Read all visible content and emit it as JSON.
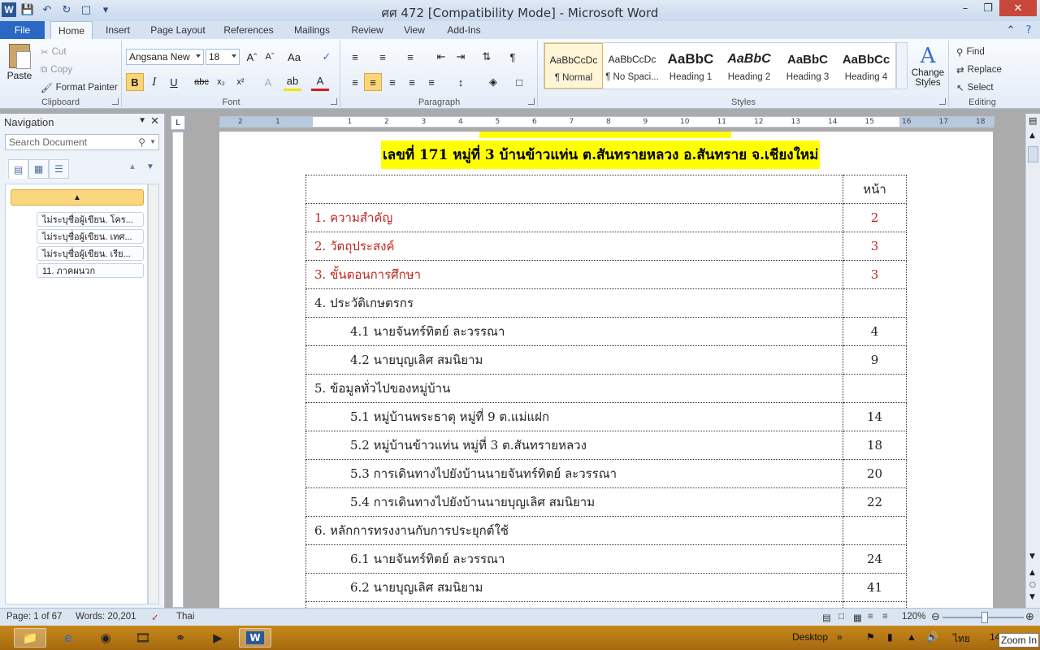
{
  "window": {
    "title": "ศศ 472 [Compatibility Mode]  -  Microsoft Word",
    "app_letter": "W"
  },
  "tabs": [
    "File",
    "Home",
    "Insert",
    "Page Layout",
    "References",
    "Mailings",
    "Review",
    "View",
    "Add-Ins"
  ],
  "ribbon": {
    "clipboard": {
      "label": "Clipboard",
      "paste": "Paste",
      "cut": "Cut",
      "copy": "Copy",
      "format_painter": "Format Painter"
    },
    "font": {
      "label": "Font",
      "font_name": "Angsana New",
      "font_size": "18"
    },
    "paragraph": {
      "label": "Paragraph"
    },
    "styles": {
      "label": "Styles",
      "items": [
        {
          "preview": "AaBbCcDc",
          "name": "¶ Normal"
        },
        {
          "preview": "AaBbCcDc",
          "name": "¶ No Spaci..."
        },
        {
          "preview": "AaBbC",
          "name": "Heading 1"
        },
        {
          "preview": "AaBbC",
          "name": "Heading 2"
        },
        {
          "preview": "AaBbC",
          "name": "Heading 3"
        },
        {
          "preview": "AaBbCc",
          "name": "Heading 4"
        }
      ],
      "change_styles": "Change Styles"
    },
    "editing": {
      "label": "Editing",
      "find": "Find",
      "replace": "Replace",
      "select": "Select"
    }
  },
  "navigation": {
    "title": "Navigation",
    "search_placeholder": "Search Document",
    "items": [
      "ไม่ระบุชื่อผู้เขียน. โคร...",
      "ไม่ระบุชื่อผู้เขียน. เทศ...",
      "ไม่ระบุชื่อผู้เขียน. เรีย...",
      "11. ภาคผนวก"
    ]
  },
  "ruler": {
    "labels": [
      "2",
      "1",
      "1",
      "2",
      "3",
      "4",
      "5",
      "6",
      "7",
      "8",
      "9",
      "10",
      "11",
      "12",
      "13",
      "14",
      "15",
      "16",
      "17",
      "18"
    ]
  },
  "document": {
    "heading_line": "เลขที่ 171 หมู่ที่ 3 บ้านข้าวแท่น ต.สันทรายหลวง อ.สันทราย จ.เชียงใหม่",
    "page_col_header": "หน้า",
    "rows": [
      {
        "text": "1. ความสำคัญ",
        "page": "2",
        "red": true,
        "indent": false
      },
      {
        "text": "2. วัตถุประสงค์",
        "page": "3",
        "red": true,
        "indent": false
      },
      {
        "text": "3. ขั้นตอนการศึกษา",
        "page": "3",
        "red": true,
        "indent": false
      },
      {
        "text": "4. ประวัติเกษตรกร",
        "page": "",
        "red": false,
        "indent": false
      },
      {
        "text": "4.1 นายจันทร์ทิตย์ ละวรรณา",
        "page": "4",
        "red": false,
        "indent": true
      },
      {
        "text": "4.2 นายบุญเลิศ สมนิยาม",
        "page": "9",
        "red": false,
        "indent": true
      },
      {
        "text": "5. ข้อมูลทั่วไปของหมู่บ้าน",
        "page": "",
        "red": false,
        "indent": false
      },
      {
        "text": "5.1  หมู่บ้านพระธาตุ หมู่ที่ 9  ต.แม่แฝก",
        "page": "14",
        "red": false,
        "indent": true
      },
      {
        "text": "5.2  หมู่บ้านข้าวแท่น หมู่ที่ 3  ต.สันทรายหลวง",
        "page": "18",
        "red": false,
        "indent": true
      },
      {
        "text": "5.3  การเดินทางไปยังบ้านนายจันทร์ทิตย์ ละวรรณา",
        "page": "20",
        "red": false,
        "indent": true
      },
      {
        "text": "5.4 การเดินทางไปยังบ้านนายบุญเลิศ สมนิยาม",
        "page": "22",
        "red": false,
        "indent": true
      },
      {
        "text": "6. หลักการทรงงานกับการประยุกต์ใช้",
        "page": "",
        "red": false,
        "indent": false
      },
      {
        "text": "6.1  นายจันทร์ทิตย์ ละวรรณา",
        "page": "24",
        "red": false,
        "indent": true
      },
      {
        "text": "6.2  นายบุญเลิศ สมนิยาม",
        "page": "41",
        "red": false,
        "indent": true
      }
    ]
  },
  "status": {
    "page": "Page: 1 of 67",
    "words": "Words: 20,201",
    "language": "Thai",
    "zoom": "120%"
  },
  "taskbar": {
    "desktop": "Desktop",
    "lang": "ไทย",
    "clock": "14",
    "tooltip": "Zoom In"
  },
  "colors": {
    "accent": "#2a68c4",
    "highlight": "#ffff00",
    "toc_red": "#c0261f",
    "taskbar": "#b8791a"
  }
}
